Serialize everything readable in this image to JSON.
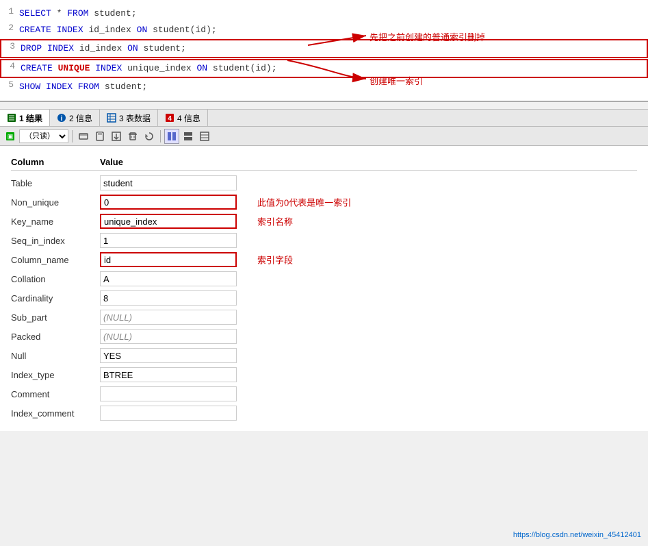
{
  "sql_lines": [
    {
      "num": "1",
      "tokens": [
        {
          "text": "SELECT",
          "class": "kw-select"
        },
        {
          "text": " * ",
          "class": "txt-normal"
        },
        {
          "text": "FROM",
          "class": "kw-from"
        },
        {
          "text": " student;",
          "class": "txt-normal"
        }
      ],
      "bordered": false
    },
    {
      "num": "2",
      "tokens": [
        {
          "text": "CREATE",
          "class": "kw-create"
        },
        {
          "text": " ",
          "class": "txt-normal"
        },
        {
          "text": "INDEX",
          "class": "kw-index"
        },
        {
          "text": " id_index ",
          "class": "txt-normal"
        },
        {
          "text": "ON",
          "class": "kw-on"
        },
        {
          "text": " student(id);",
          "class": "txt-normal"
        }
      ],
      "bordered": false
    },
    {
      "num": "3",
      "tokens": [
        {
          "text": "DROP",
          "class": "kw-drop"
        },
        {
          "text": " ",
          "class": "txt-normal"
        },
        {
          "text": "INDEX",
          "class": "kw-index"
        },
        {
          "text": "  id_index ",
          "class": "txt-normal"
        },
        {
          "text": "ON",
          "class": "kw-on"
        },
        {
          "text": " student;",
          "class": "txt-normal"
        }
      ],
      "bordered": true,
      "annotation": "先把之前创建的普通索引删掉",
      "annotation_pos": "right"
    },
    {
      "num": "4",
      "tokens": [
        {
          "text": "CREATE",
          "class": "kw-create"
        },
        {
          "text": " ",
          "class": "txt-normal"
        },
        {
          "text": "UNIQUE",
          "class": "kw-unique"
        },
        {
          "text": " ",
          "class": "txt-normal"
        },
        {
          "text": "INDEX",
          "class": "kw-index"
        },
        {
          "text": " unique_index ",
          "class": "txt-normal"
        },
        {
          "text": "ON",
          "class": "kw-on"
        },
        {
          "text": " student(id);",
          "class": "txt-normal"
        }
      ],
      "bordered": true
    },
    {
      "num": "5",
      "tokens": [
        {
          "text": "SHOW",
          "class": "kw-show"
        },
        {
          "text": " ",
          "class": "txt-normal"
        },
        {
          "text": "INDEX",
          "class": "kw-index"
        },
        {
          "text": " ",
          "class": "txt-normal"
        },
        {
          "text": "FROM",
          "class": "kw-from"
        },
        {
          "text": " student;",
          "class": "txt-normal"
        }
      ],
      "bordered": false,
      "annotation": "创建唯一索引",
      "annotation_pos": "arrow-below-right"
    }
  ],
  "tabs": [
    {
      "id": "results",
      "label": "1 结果",
      "icon": "grid",
      "icon_color": "green",
      "active": true
    },
    {
      "id": "info",
      "label": "2 信息",
      "icon": "info",
      "icon_color": "blue",
      "active": false
    },
    {
      "id": "tabledata",
      "label": "3 表数据",
      "icon": "table",
      "icon_color": "blue",
      "active": false
    },
    {
      "id": "info4",
      "label": "4 信息",
      "icon": "warning",
      "icon_color": "red",
      "active": false
    }
  ],
  "toolbar": {
    "readonly_label": "（只读）",
    "buttons": [
      "export",
      "grid-view",
      "save",
      "delete",
      "refresh",
      "layout1",
      "layout2",
      "layout3"
    ]
  },
  "table_headers": [
    "Column",
    "Value"
  ],
  "table_rows": [
    {
      "col": "Table",
      "value": "student",
      "highlighted": false,
      "annotation": null
    },
    {
      "col": "Non_unique",
      "value": "0",
      "highlighted": true,
      "annotation": "此值为0代表是唯一索引"
    },
    {
      "col": "Key_name",
      "value": "unique_index",
      "highlighted": true,
      "annotation": "索引名称"
    },
    {
      "col": "Seq_in_index",
      "value": "1",
      "highlighted": false,
      "annotation": null
    },
    {
      "col": "Column_name",
      "value": "id",
      "highlighted": true,
      "annotation": "索引字段"
    },
    {
      "col": "Collation",
      "value": "A",
      "highlighted": false,
      "annotation": null
    },
    {
      "col": "Cardinality",
      "value": "8",
      "highlighted": false,
      "annotation": null
    },
    {
      "col": "Sub_part",
      "value": "(NULL)",
      "highlighted": false,
      "annotation": null
    },
    {
      "col": "Packed",
      "value": "(NULL)",
      "highlighted": false,
      "annotation": null
    },
    {
      "col": "Null",
      "value": "YES",
      "highlighted": false,
      "annotation": null
    },
    {
      "col": "Index_type",
      "value": "BTREE",
      "highlighted": false,
      "annotation": null
    },
    {
      "col": "Comment",
      "value": "",
      "highlighted": false,
      "annotation": null
    },
    {
      "col": "Index_comment",
      "value": "",
      "highlighted": false,
      "annotation": null
    }
  ],
  "watermark": "https://blog.csdn.net/weixin_45412401"
}
